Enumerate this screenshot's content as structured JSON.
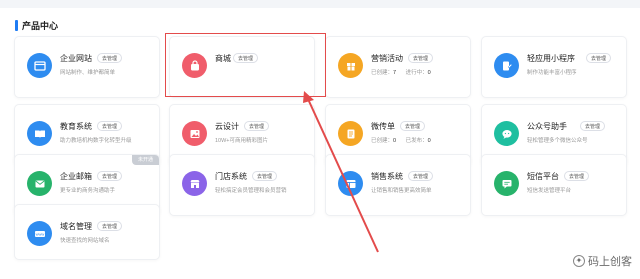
{
  "section": {
    "title": "产品中心"
  },
  "cards": [
    {
      "name": "企业网站",
      "manage": "去管理",
      "desc": "网站制作、维护都简单",
      "color": "#2e8cf0",
      "icon": "browser-icon"
    },
    {
      "name": "商城",
      "manage": "去管理",
      "desc": "",
      "color": "#f05d6b",
      "icon": "shopping-bag-icon"
    },
    {
      "name": "营销活动",
      "manage": "去管理",
      "stat1_label": "已创建：",
      "stat1_value": "7",
      "stat2_label": "进行中：",
      "stat2_value": "0",
      "color": "#f5a623",
      "icon": "gift-icon"
    },
    {
      "name": "轻应用小程序",
      "manage": "去管理",
      "desc": "制作功能丰富小程序",
      "color": "#2e8cf0",
      "icon": "mini-program-icon"
    },
    {
      "name": "教育系统",
      "manage": "去管理",
      "desc": "助力教培机构数字化转型升级",
      "color": "#2e8cf0",
      "icon": "book-icon"
    },
    {
      "name": "云设计",
      "manage": "去管理",
      "desc": "10W+可商用精彩图片",
      "color": "#f05d6b",
      "icon": "image-icon"
    },
    {
      "name": "微传单",
      "manage": "去管理",
      "stat1_label": "已创建：",
      "stat1_value": "0",
      "stat2_label": "已发布：",
      "stat2_value": "0",
      "color": "#f5a623",
      "icon": "flyer-icon"
    },
    {
      "name": "公众号助手",
      "manage": "去管理",
      "desc": "轻松管理多个微信公众号",
      "color": "#1fbfa0",
      "icon": "wechat-icon"
    },
    {
      "name": "企业邮箱",
      "manage": "去管理",
      "desc": "更专业的商务沟通助手",
      "badge": "未开通",
      "color": "#27b36b",
      "icon": "mail-icon"
    },
    {
      "name": "门店系统",
      "manage": "去管理",
      "desc": "轻松搞定会员管理和会员营销",
      "color": "#8b64e8",
      "icon": "store-icon"
    },
    {
      "name": "销售系统",
      "manage": "去管理",
      "desc": "让销售和销售更高效简单",
      "color": "#2e8cf0",
      "icon": "sales-icon"
    },
    {
      "name": "短信平台",
      "manage": "去管理",
      "desc": "短信发送管理平台",
      "color": "#27b36b",
      "icon": "message-icon"
    },
    {
      "name": "域名管理",
      "manage": "去管理",
      "desc": "快速查找的网站域名",
      "color": "#2e8cf0",
      "icon": "domain-icon"
    }
  ],
  "watermark": {
    "text": "码上创客"
  }
}
